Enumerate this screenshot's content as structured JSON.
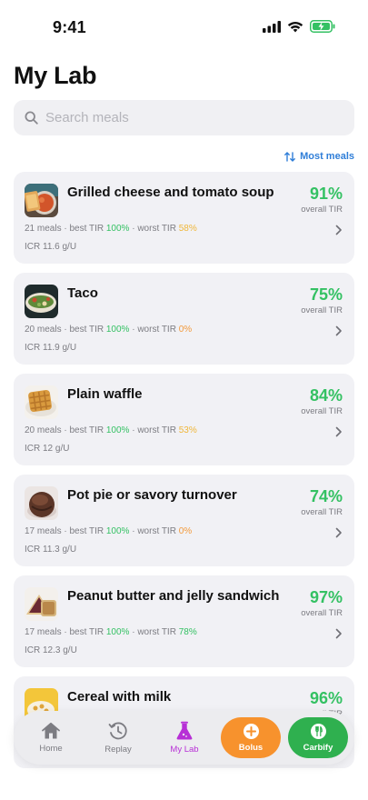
{
  "status": {
    "time": "9:41"
  },
  "title": "My Lab",
  "search": {
    "placeholder": "Search meals",
    "value": ""
  },
  "sort": {
    "label": "Most meals"
  },
  "colors": {
    "good": "#34c163",
    "warn": "#f0b73a",
    "bad": "#f29a3c",
    "accent": "#2f7ed8",
    "active_tab": "#b72fd6",
    "bolus": "#f7922d",
    "carbify": "#2fb04f"
  },
  "meals": [
    {
      "name": "Grilled cheese and tomato soup",
      "tir": "91%",
      "tir_label": "overall TIR",
      "meals_count": "21 meals",
      "best_prefix": " · best TIR ",
      "best": "100%",
      "worst_prefix": " · worst TIR ",
      "worst": "58%",
      "worst_level": "warn",
      "icr": "ICR 11.6 g/U",
      "icon": "grilled-cheese-soup-photo"
    },
    {
      "name": "Taco",
      "tir": "75%",
      "tir_label": "overall TIR",
      "meals_count": "20 meals",
      "best_prefix": " · best TIR ",
      "best": "100%",
      "worst_prefix": " · worst TIR ",
      "worst": "0%",
      "worst_level": "bad",
      "icr": "ICR 11.9 g/U",
      "icon": "taco-photo"
    },
    {
      "name": "Plain waffle",
      "tir": "84%",
      "tir_label": "overall TIR",
      "meals_count": "20 meals",
      "best_prefix": " · best TIR ",
      "best": "100%",
      "worst_prefix": " · worst TIR ",
      "worst": "53%",
      "worst_level": "warn",
      "icr": "ICR 12 g/U",
      "icon": "waffle-photo"
    },
    {
      "name": "Pot pie or savory turnover",
      "tir": "74%",
      "tir_label": "overall TIR",
      "meals_count": "17 meals",
      "best_prefix": " · best TIR ",
      "best": "100%",
      "worst_prefix": " · worst TIR ",
      "worst": "0%",
      "worst_level": "bad",
      "icr": "ICR 11.3 g/U",
      "icon": "pot-pie-photo"
    },
    {
      "name": "Peanut butter and jelly sandwich",
      "tir": "97%",
      "tir_label": "overall TIR",
      "meals_count": "17 meals",
      "best_prefix": " · best TIR ",
      "best": "100%",
      "worst_prefix": " · worst TIR ",
      "worst": "78%",
      "worst_level": "good",
      "icr": "ICR 12.3 g/U",
      "icon": "pbj-sandwich-photo"
    },
    {
      "name": "Cereal with milk",
      "tir": "96%",
      "tir_label": "overall TIR",
      "icon": "cereal-photo"
    }
  ],
  "tabs": {
    "home": "Home",
    "replay": "Replay",
    "mylab": "My Lab",
    "bolus": "Bolus",
    "carbify": "Carbify"
  }
}
